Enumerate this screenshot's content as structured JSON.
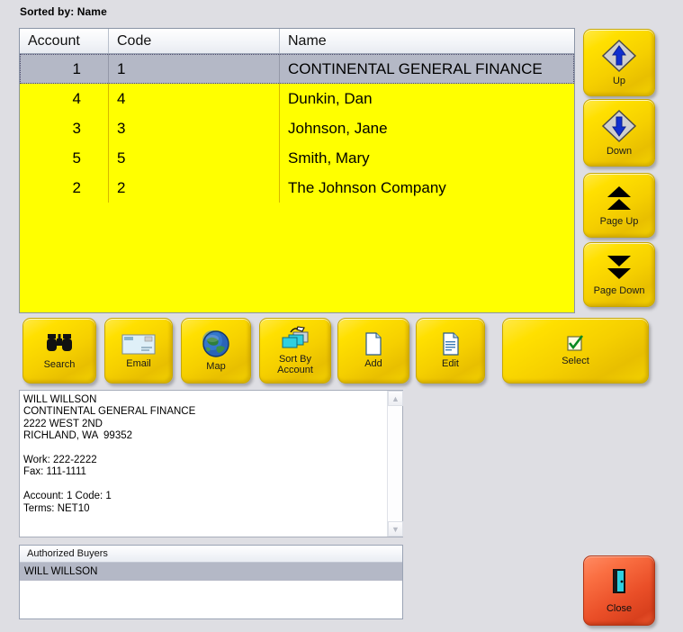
{
  "sort_status": "Sorted by: Name",
  "grid": {
    "columns": [
      "Account",
      "Code",
      "Name"
    ],
    "rows": [
      {
        "account": "1",
        "code": "1",
        "name": "CONTINENTAL GENERAL FINANCE",
        "selected": true
      },
      {
        "account": "4",
        "code": "4",
        "name": "Dunkin, Dan",
        "selected": false
      },
      {
        "account": "3",
        "code": "3",
        "name": "Johnson, Jane",
        "selected": false
      },
      {
        "account": "5",
        "code": "5",
        "name": "Smith, Mary",
        "selected": false
      },
      {
        "account": "2",
        "code": "2",
        "name": "The Johnson Company",
        "selected": false
      }
    ]
  },
  "nav_buttons": [
    {
      "label": "Up",
      "icon": "arrow-up-diamond-icon"
    },
    {
      "label": "Down",
      "icon": "arrow-down-diamond-icon"
    },
    {
      "label": "Page Up",
      "icon": "double-arrow-up-icon"
    },
    {
      "label": "Page Down",
      "icon": "double-arrow-down-icon"
    }
  ],
  "toolbar": {
    "search": {
      "label": "Search",
      "icon": "binoculars-icon"
    },
    "email": {
      "label": "Email",
      "icon": "envelope-icon"
    },
    "map": {
      "label": "Map",
      "icon": "globe-icon"
    },
    "sort": {
      "label": "Sort By\nAccount",
      "label_line1": "Sort By",
      "label_line2": "Account",
      "icon": "sort-cards-icon"
    },
    "add": {
      "label": "Add",
      "icon": "new-document-icon"
    },
    "edit": {
      "label": "Edit",
      "icon": "edit-document-icon"
    },
    "select": {
      "label": "Select",
      "icon": "green-checkbox-icon"
    }
  },
  "detail": {
    "text": "WILL WILLSON\nCONTINENTAL GENERAL FINANCE\n2222 WEST 2ND\nRICHLAND, WA  99352\n\nWork: 222-2222\nFax: 111-1111\n\nAccount: 1 Code: 1\nTerms: NET10"
  },
  "buyers": {
    "header": "Authorized Buyers",
    "items": [
      {
        "name": "WILL WILLSON",
        "selected": true
      }
    ]
  },
  "close_button": {
    "label": "Close",
    "icon": "exit-door-icon"
  },
  "colors": {
    "background": "#dedee3",
    "grid_yellow": "#ffff00",
    "row_selected": "#b4b8c6",
    "button_yellow": "#ffe000",
    "close_red": "#ea4f28"
  }
}
